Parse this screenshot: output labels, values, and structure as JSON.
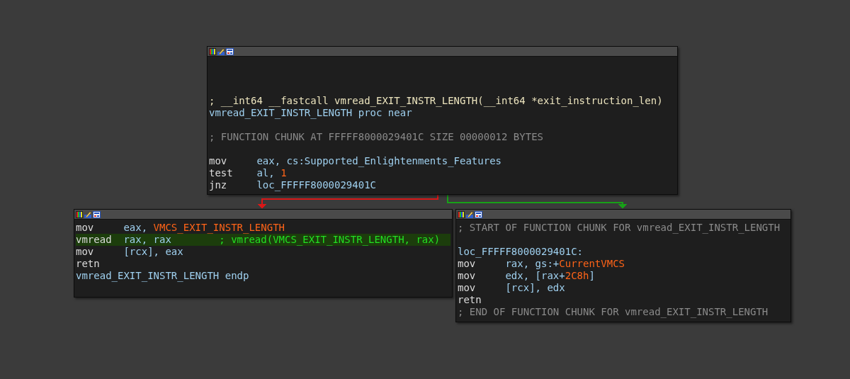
{
  "nodes": [
    {
      "lines": [
        {
          "kind": "blank"
        },
        {
          "kind": "blank"
        },
        {
          "kind": "blank"
        },
        {
          "kind": "code",
          "highlighted": false,
          "segments": [
            {
              "kind": "sig",
              "text": "; __int64 __fastcall vmread_EXIT_INSTR_LENGTH(__int64 *exit_instruction_len)"
            }
          ]
        },
        {
          "kind": "code",
          "highlighted": false,
          "segments": [
            {
              "kind": "name",
              "text": "vmread_EXIT_INSTR_LENGTH proc near"
            }
          ]
        },
        {
          "kind": "blank"
        },
        {
          "kind": "code",
          "highlighted": false,
          "segments": [
            {
              "kind": "comment",
              "text": "; FUNCTION CHUNK AT FFFFF8000029401C SIZE 00000012 BYTES"
            }
          ]
        },
        {
          "kind": "blank"
        },
        {
          "kind": "code",
          "highlighted": false,
          "segments": [
            {
              "kind": "op",
              "text": "mov"
            },
            {
              "kind": "name",
              "text": "eax, cs:Supported_Enlightenments_Features"
            }
          ]
        },
        {
          "kind": "code",
          "highlighted": false,
          "segments": [
            {
              "kind": "op",
              "text": "test"
            },
            {
              "kind": "name",
              "text": "al, "
            },
            {
              "kind": "const",
              "text": "1"
            }
          ]
        },
        {
          "kind": "code",
          "highlighted": false,
          "segments": [
            {
              "kind": "op",
              "text": "jnz"
            },
            {
              "kind": "name",
              "text": "loc_FFFFF8000029401C"
            }
          ]
        }
      ]
    },
    {
      "lines": [
        {
          "kind": "code",
          "highlighted": false,
          "segments": [
            {
              "kind": "op",
              "text": "mov"
            },
            {
              "kind": "name",
              "text": "eax, "
            },
            {
              "kind": "const",
              "text": "VMCS_EXIT_INSTR_LENGTH"
            }
          ]
        },
        {
          "kind": "code",
          "highlighted": true,
          "segments": [
            {
              "kind": "op",
              "text": "vmread"
            },
            {
              "kind": "name",
              "text": "rax, rax"
            },
            {
              "kind": "auto",
              "text": "; vmread(VMCS_EXIT_INSTR_LENGTH, rax)"
            }
          ]
        },
        {
          "kind": "code",
          "highlighted": false,
          "segments": [
            {
              "kind": "op",
              "text": "mov"
            },
            {
              "kind": "name",
              "text": "[rcx], eax"
            }
          ]
        },
        {
          "kind": "code",
          "highlighted": false,
          "segments": [
            {
              "kind": "op",
              "text": "retn"
            }
          ]
        },
        {
          "kind": "code",
          "highlighted": false,
          "segments": [
            {
              "kind": "name",
              "text": "vmread_EXIT_INSTR_LENGTH endp"
            }
          ]
        }
      ]
    },
    {
      "lines": [
        {
          "kind": "code",
          "highlighted": false,
          "segments": [
            {
              "kind": "comment",
              "text": "; START OF FUNCTION CHUNK FOR vmread_EXIT_INSTR_LENGTH"
            }
          ]
        },
        {
          "kind": "blank"
        },
        {
          "kind": "code",
          "highlighted": false,
          "segments": [
            {
              "kind": "name",
              "text": "loc_FFFFF8000029401C:"
            }
          ]
        },
        {
          "kind": "code",
          "highlighted": false,
          "segments": [
            {
              "kind": "op",
              "text": "mov"
            },
            {
              "kind": "name",
              "text": "rax, gs:+"
            },
            {
              "kind": "const",
              "text": "CurrentVMCS"
            }
          ]
        },
        {
          "kind": "code",
          "highlighted": false,
          "segments": [
            {
              "kind": "op",
              "text": "mov"
            },
            {
              "kind": "name",
              "text": "edx, [rax+"
            },
            {
              "kind": "const",
              "text": "2C8h"
            },
            {
              "kind": "name",
              "text": "]"
            }
          ]
        },
        {
          "kind": "code",
          "highlighted": false,
          "segments": [
            {
              "kind": "op",
              "text": "mov"
            },
            {
              "kind": "name",
              "text": "[rcx], edx"
            }
          ]
        },
        {
          "kind": "code",
          "highlighted": false,
          "segments": [
            {
              "kind": "op",
              "text": "retn"
            }
          ]
        },
        {
          "kind": "code",
          "highlighted": false,
          "segments": [
            {
              "kind": "comment",
              "text": "; END OF FUNCTION CHUNK FOR vmread_EXIT_INSTR_LENGTH"
            }
          ]
        }
      ]
    }
  ],
  "edges": [
    {
      "color": "#d81818"
    },
    {
      "color": "#18a018"
    }
  ]
}
